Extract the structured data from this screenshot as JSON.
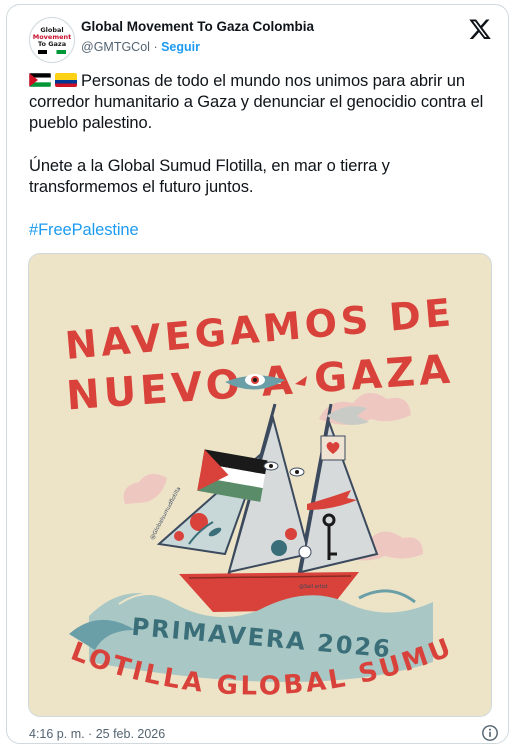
{
  "tweet": {
    "author_name": "Global Movement To Gaza Colombia",
    "handle": "@GMTGCol",
    "separator": "·",
    "follow_label": "Seguir",
    "paragraph1": "Personas de todo el mundo nos unimos para abrir un corredor humanitario a Gaza y denunciar el genocidio contra el pueblo palestino.",
    "paragraph2": "Únete a la Global Sumud Flotilla, en mar o tierra y transformemos el futuro juntos.",
    "hashtag": "#FreePalestine",
    "timestamp": "4:16 p. m. · 25 feb. 2026"
  },
  "avatar": {
    "line1": "Global",
    "line2": "Movement",
    "line3": "To Gaza"
  },
  "poster": {
    "title_line1": "NAVEGAMOS DE",
    "title_line2": "NUEVO A GAZA",
    "season": "PRIMAVERA 2026",
    "bottom_banner": "FLOTILLA GLOBAL SUMUD",
    "sail_credit": "@Globalsumudflotilla",
    "hull_credit": "@Sail artist"
  },
  "icons": {
    "palestine_flag": "palestine-flag-icon",
    "colombia_flag": "colombia-flag-icon",
    "x_logo": "x-logo-icon",
    "info": "info-icon"
  },
  "colors": {
    "link": "#1d9bf0",
    "text": "#0f1419",
    "muted": "#536471",
    "poster_bg": "#ede4c8",
    "poster_red": "#d8423a",
    "poster_teal": "#6b9fa8"
  }
}
